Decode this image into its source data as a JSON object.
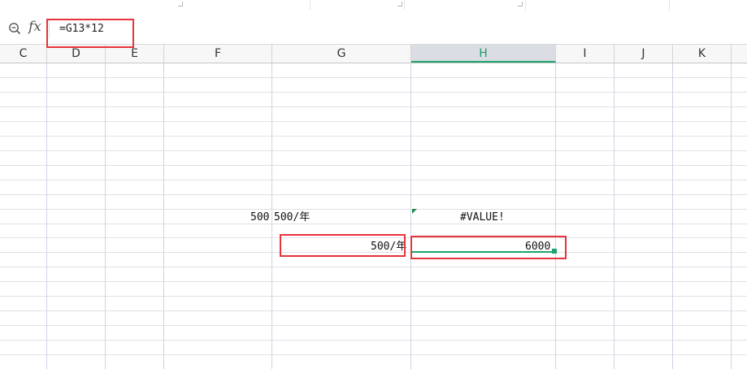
{
  "formula_bar": {
    "formula": "=G13*12",
    "icons": [
      "zoom-icon",
      "fx-icon"
    ]
  },
  "columns": [
    {
      "label": "C",
      "selected": false
    },
    {
      "label": "D",
      "selected": false
    },
    {
      "label": "E",
      "selected": false
    },
    {
      "label": "F",
      "selected": false
    },
    {
      "label": "G",
      "selected": false
    },
    {
      "label": "H",
      "selected": true
    },
    {
      "label": "I",
      "selected": false
    },
    {
      "label": "J",
      "selected": false
    },
    {
      "label": "K",
      "selected": false
    }
  ],
  "cells": {
    "f12": "500",
    "g12": "500/年",
    "h12": "#VALUE!",
    "g13": "500/年",
    "h13": "6000"
  },
  "colors": {
    "selection": "#1fa36a",
    "highlight_box": "#e5343b",
    "selected_header_bg": "#dadde3"
  }
}
